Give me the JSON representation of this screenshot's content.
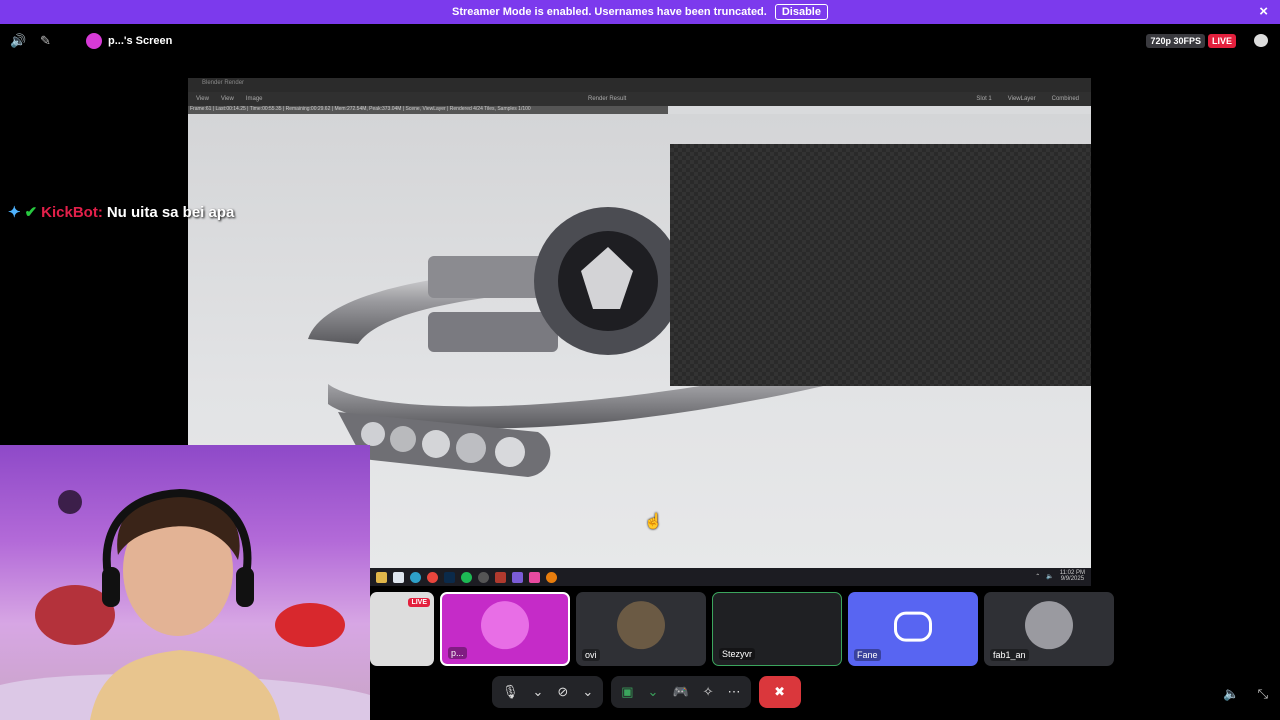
{
  "banner": {
    "message": "Streamer Mode is enabled. Usernames have been truncated.",
    "disable_label": "Disable",
    "close_icon": "×"
  },
  "topbar": {
    "screen_title": "p...'s Screen",
    "quality": "720p 30FPS",
    "live": "LIVE"
  },
  "chat": {
    "username": "KickBot:",
    "message": "Nu uita sa bei apa"
  },
  "tiles": [
    {
      "name": "p...",
      "badge": "LIVE"
    },
    {
      "name": "ovi"
    },
    {
      "name": "Stezyvr"
    },
    {
      "name": "Fane"
    },
    {
      "name": "fab1_an"
    }
  ],
  "blender": {
    "window_title": "Blender Render",
    "menu": [
      "View",
      "View",
      "Image"
    ],
    "center": "Render Result",
    "right": [
      "Slot 1",
      "ViewLayer",
      "Combined"
    ],
    "stats": "Frame:61 | Last:00:14.25 | Time:00:55.35 | Remaining:00:29.62 | Mem:272.54M, Peak:373.04M | Scene, ViewLayer | Rendered 4/24 Tiles, Samples 1/100",
    "time": "11:02 PM",
    "date": "9/9/2025"
  },
  "colors": {
    "banner": "#7c3aed",
    "live": "#e3203d",
    "discord": "#5865f2",
    "end_call": "#da373c"
  }
}
